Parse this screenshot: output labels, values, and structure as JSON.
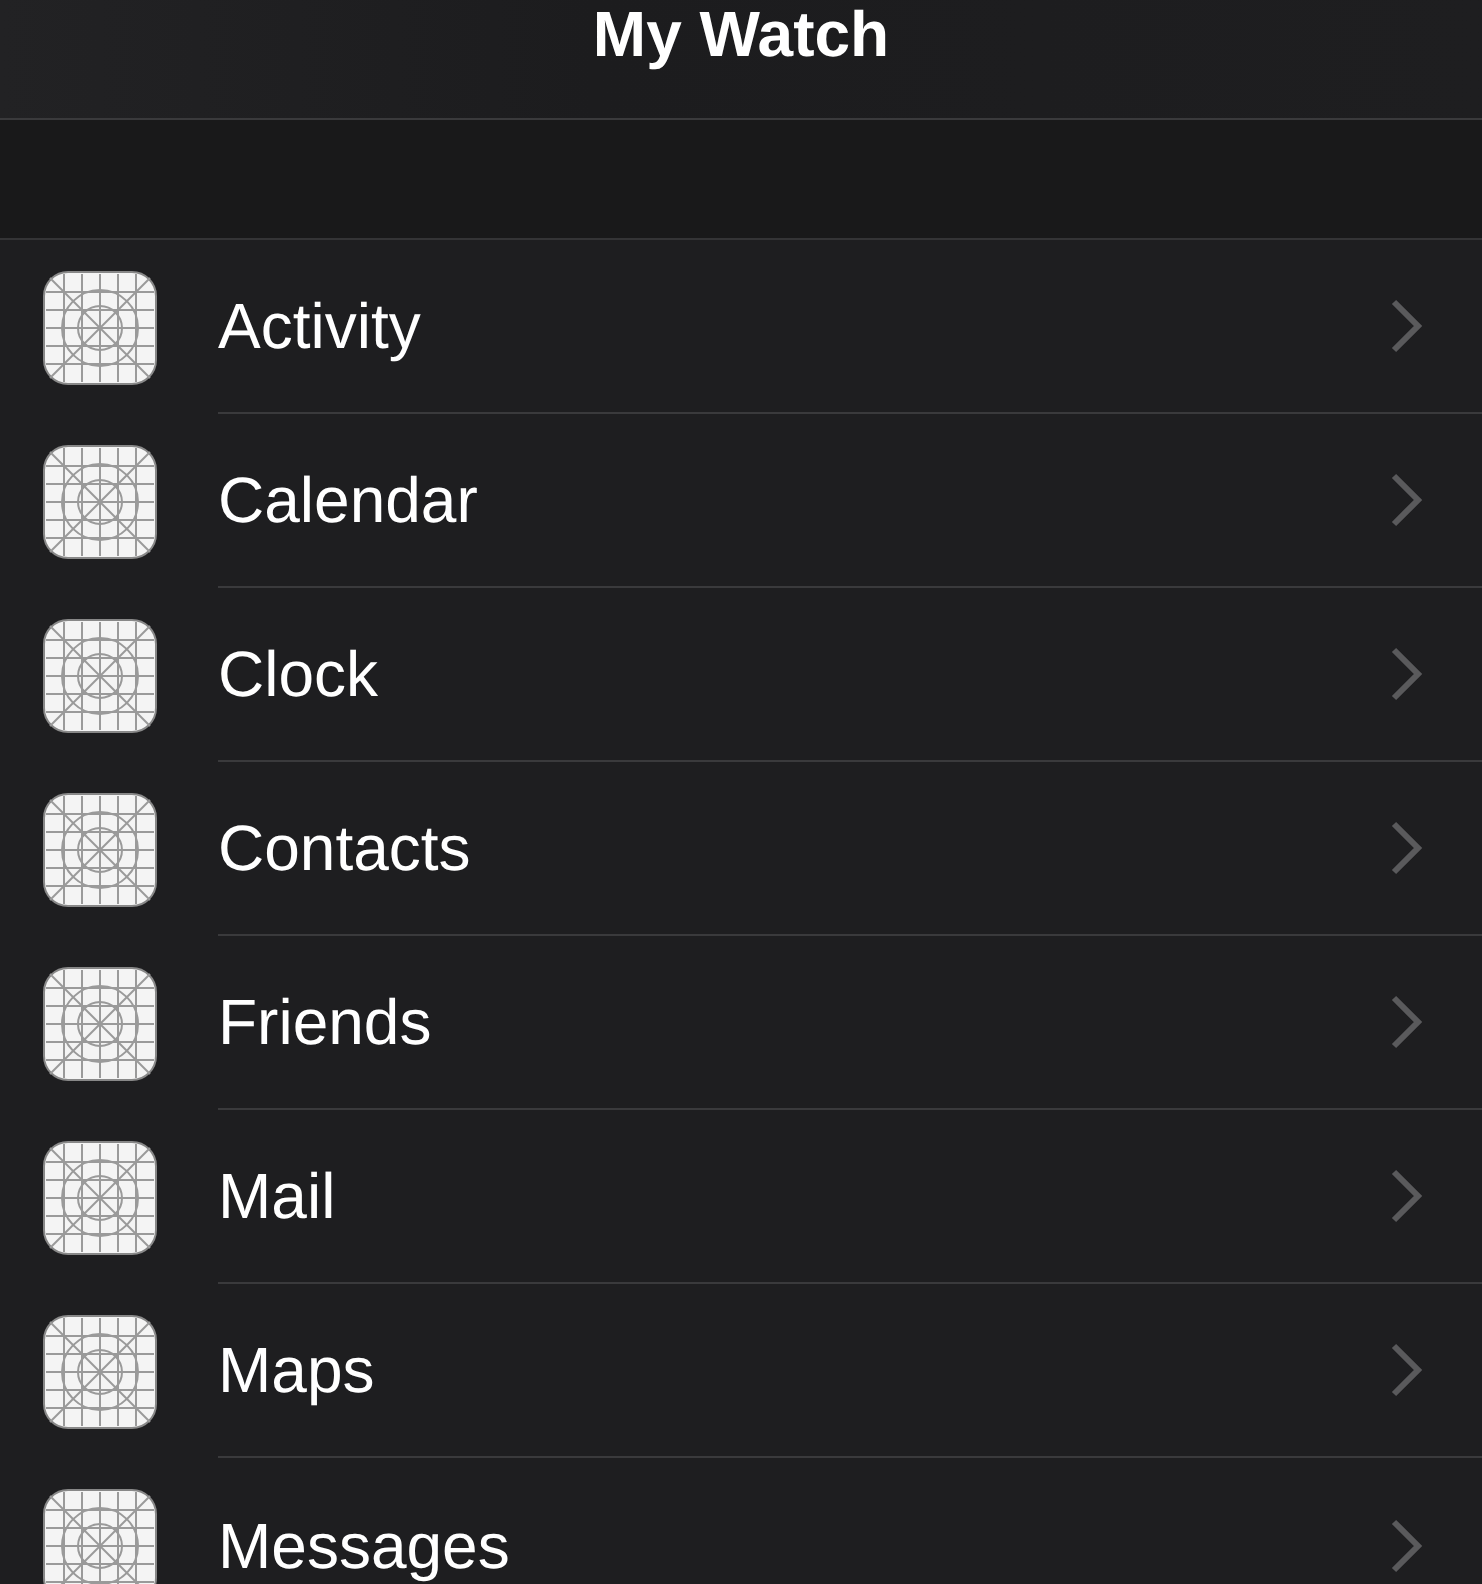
{
  "navigation_bar": {
    "title": "My Watch"
  },
  "apps": [
    {
      "label": "Activity"
    },
    {
      "label": "Calendar"
    },
    {
      "label": "Clock"
    },
    {
      "label": "Contacts"
    },
    {
      "label": "Friends"
    },
    {
      "label": "Mail"
    },
    {
      "label": "Maps"
    },
    {
      "label": "Messages"
    }
  ]
}
